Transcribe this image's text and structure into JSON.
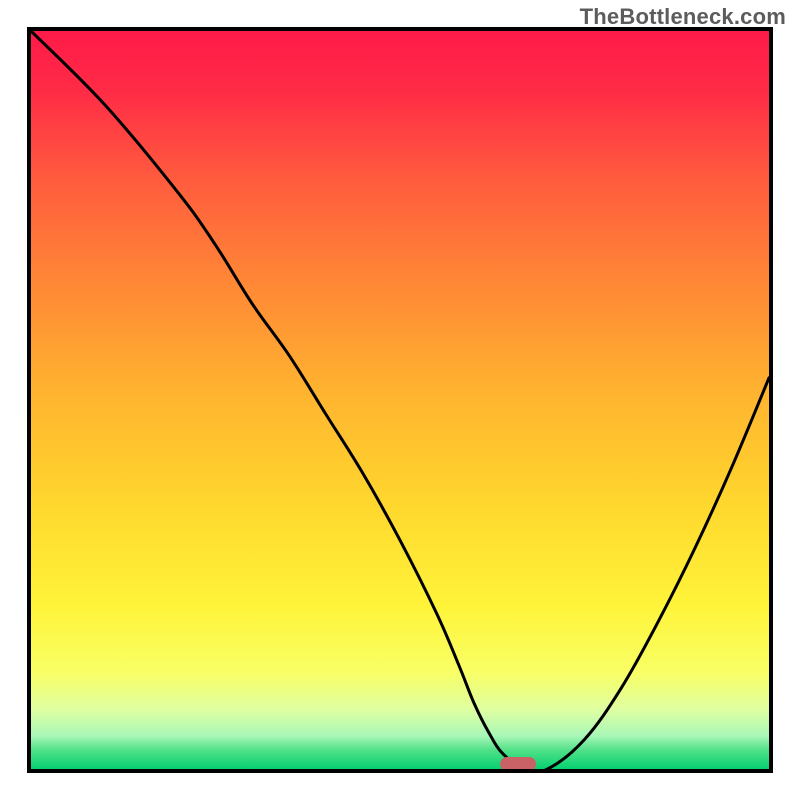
{
  "watermark": "TheBottleneck.com",
  "chart_data": {
    "type": "line",
    "title": "",
    "xlabel": "",
    "ylabel": "",
    "xlim": [
      0,
      100
    ],
    "ylim": [
      0,
      100
    ],
    "grid": false,
    "legend": false,
    "background": {
      "type": "vertical-gradient",
      "stops": [
        {
          "offset": 0.0,
          "color": "#ff1a49"
        },
        {
          "offset": 0.08,
          "color": "#ff2b46"
        },
        {
          "offset": 0.2,
          "color": "#ff5b3e"
        },
        {
          "offset": 0.35,
          "color": "#ff8a35"
        },
        {
          "offset": 0.5,
          "color": "#ffb62f"
        },
        {
          "offset": 0.65,
          "color": "#ffd92e"
        },
        {
          "offset": 0.78,
          "color": "#fff43a"
        },
        {
          "offset": 0.87,
          "color": "#f8ff66"
        },
        {
          "offset": 0.92,
          "color": "#deffa2"
        },
        {
          "offset": 0.955,
          "color": "#a9f7b8"
        },
        {
          "offset": 0.975,
          "color": "#4fe086"
        },
        {
          "offset": 1.0,
          "color": "#06d173"
        }
      ]
    },
    "series": [
      {
        "name": "bottleneck-curve",
        "x": [
          0,
          10,
          20,
          25,
          30,
          35,
          40,
          45,
          50,
          55,
          58,
          60,
          62,
          64,
          67,
          70,
          75,
          80,
          85,
          90,
          95,
          100
        ],
        "y": [
          100,
          90,
          78,
          71,
          63,
          56,
          48,
          40,
          31,
          21,
          14,
          9,
          5,
          2,
          0,
          0,
          4,
          11,
          20,
          30,
          41,
          53
        ]
      }
    ],
    "marker": {
      "name": "optimal-point",
      "x": 66,
      "y": 0,
      "shape": "pill",
      "color": "#c96266"
    }
  }
}
